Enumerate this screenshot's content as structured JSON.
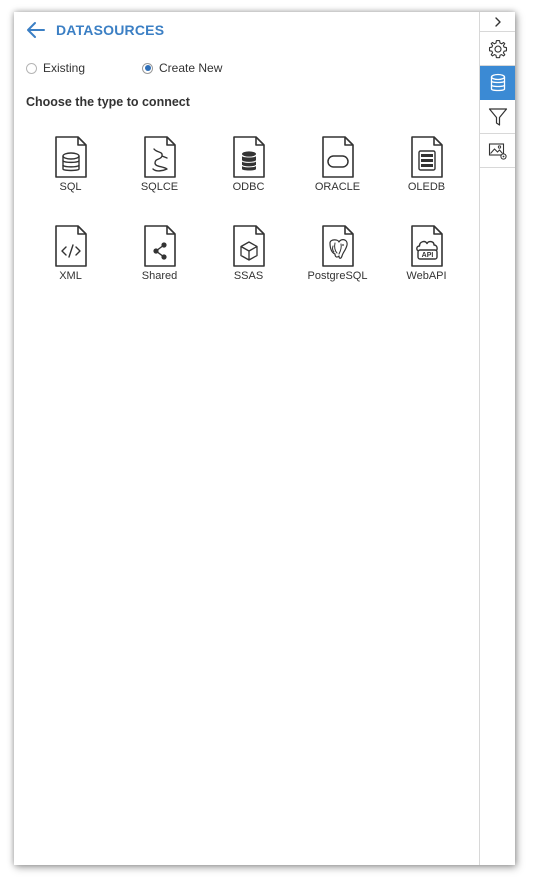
{
  "header": {
    "title": "DATASOURCES",
    "back_icon": "arrow-left-icon"
  },
  "mode": {
    "options": [
      {
        "label": "Existing",
        "checked": false
      },
      {
        "label": "Create New",
        "checked": true
      }
    ]
  },
  "subtitle": "Choose the type to connect",
  "datasources": [
    {
      "label": "SQL",
      "icon": "sql-database-icon"
    },
    {
      "label": "SQLCE",
      "icon": "sqlce-icon"
    },
    {
      "label": "ODBC",
      "icon": "odbc-database-icon"
    },
    {
      "label": "ORACLE",
      "icon": "oracle-icon"
    },
    {
      "label": "OLEDB",
      "icon": "oledb-icon"
    },
    {
      "label": "XML",
      "icon": "xml-code-icon"
    },
    {
      "label": "Shared",
      "icon": "share-icon"
    },
    {
      "label": "SSAS",
      "icon": "cube-icon"
    },
    {
      "label": "PostgreSQL",
      "icon": "postgresql-elephant-icon"
    },
    {
      "label": "WebAPI",
      "icon": "api-cloud-icon"
    }
  ],
  "rail": {
    "items": [
      {
        "icon": "chevron-right-icon"
      },
      {
        "icon": "gear-icon"
      },
      {
        "icon": "database-icon",
        "active": true
      },
      {
        "icon": "filter-icon"
      },
      {
        "icon": "image-settings-icon"
      }
    ]
  },
  "colors": {
    "accent": "#3b8ad4",
    "title": "#3b7fc4",
    "text": "#333333",
    "icon_stroke": "#333333"
  }
}
